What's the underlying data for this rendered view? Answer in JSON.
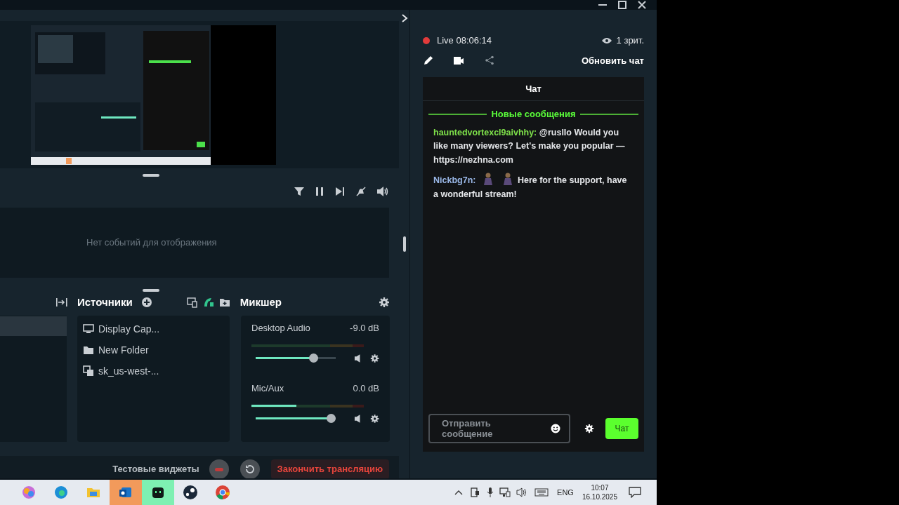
{
  "scenes": [
    {
      "selected": true
    }
  ],
  "events": {
    "empty_text": "Нет событий для отображения"
  },
  "sources": {
    "title": "Источники",
    "items": [
      {
        "kind": "display",
        "label": "Display Cap..."
      },
      {
        "kind": "folder",
        "label": "New Folder"
      },
      {
        "kind": "group",
        "label": "sk_us-west-..."
      }
    ]
  },
  "mixer": {
    "title": "Микшер",
    "channels": [
      {
        "name": "Desktop Audio",
        "reading": "-9.0 dB",
        "meter": {
          "level": 0
        },
        "volume": {
          "level": 0.75
        }
      },
      {
        "name": "Mic/Aux",
        "reading": "0.0 dB",
        "meter": {
          "level": 0.4
        },
        "volume": {
          "level": 1
        }
      }
    ]
  },
  "footer": {
    "test_widgets": "Тестовые виджеты",
    "end_stream": "Закончить трансляцию"
  },
  "stream": {
    "status": "Live 08:06:14",
    "viewers": "1 зрит.",
    "refresh_chat": "Обновить чат"
  },
  "chat": {
    "title": "Чат",
    "divider": "Новые сообщения",
    "messages": [
      {
        "user": "hauntedvortexcl9aivhhy:",
        "color": "#7ee04a",
        "text": "@ruslIo Would you like many viewers? Let's make you popular — https://nezhna.com"
      },
      {
        "user": "Nickbg7n:",
        "color": "#9ab8e8",
        "emotes": [
          {
            "kind": "figure"
          },
          {
            "kind": "figure"
          }
        ],
        "text": "Here for the support, have a wonderful stream!"
      }
    ],
    "input": {
      "placeholder": "Отправить сообщение"
    },
    "send": "Чат"
  },
  "taskbar": {
    "language": "ENG",
    "time": "10:07",
    "date": "16.10.2025"
  }
}
